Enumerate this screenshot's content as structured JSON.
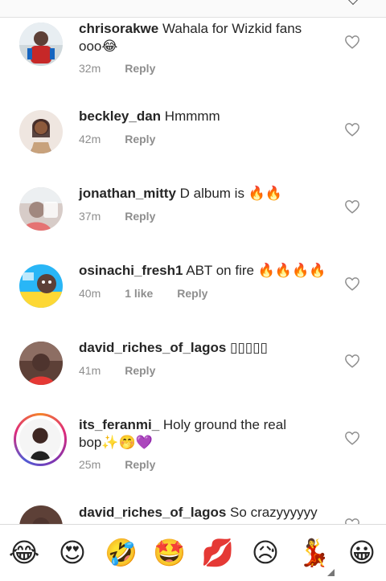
{
  "comments": [
    {
      "username": "chrisorakwe",
      "text": "Wahala for Wizkid fans ooo😂",
      "time": "32m",
      "likes": "",
      "reply": "Reply"
    },
    {
      "username": "beckley_dan",
      "text": "Hmmmm",
      "time": "42m",
      "likes": "",
      "reply": "Reply"
    },
    {
      "username": "jonathan_mitty",
      "text": "D album is 🔥🔥",
      "time": "37m",
      "likes": "",
      "reply": "Reply"
    },
    {
      "username": "osinachi_fresh1",
      "text": "ABT on fire 🔥🔥🔥🔥",
      "time": "40m",
      "likes": "1 like",
      "reply": "Reply"
    },
    {
      "username": "david_riches_of_lagos",
      "text": "▯▯▯▯▯",
      "time": "41m",
      "likes": "",
      "reply": "Reply"
    },
    {
      "username": "its_feranmi_",
      "text": "Holy ground the real bop✨🤭💜",
      "time": "25m",
      "likes": "",
      "reply": "Reply"
    },
    {
      "username": "david_riches_of_lagos",
      "text": "So crazyyyyyy",
      "time": "",
      "likes": "",
      "reply": ""
    }
  ],
  "emoji_bar": [
    "😂",
    "😍",
    "🤣",
    "🤩",
    "💋",
    "😥",
    "💃",
    "😀"
  ],
  "colors": {
    "text": "#262626",
    "meta": "#8e8e8e",
    "heart_outline": "#8e8e8e"
  }
}
